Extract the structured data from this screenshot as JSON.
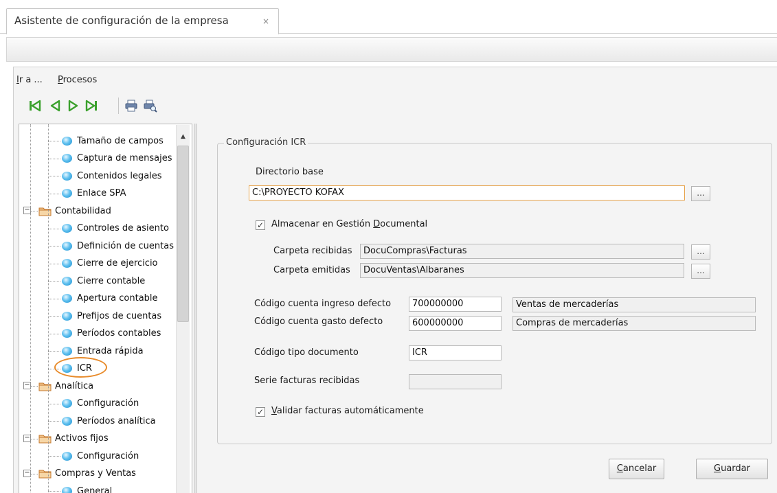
{
  "tab": {
    "title": "Asistente de configuración de la empresa",
    "close": "×"
  },
  "menu": [
    {
      "label": "Ir a ...",
      "accel": "I",
      "rest": "r a ..."
    },
    {
      "label": "Procesos",
      "accel": "P",
      "rest": "rocesos"
    }
  ],
  "toolbar": {
    "icons": [
      "first-record-icon",
      "previous-record-icon",
      "next-record-icon",
      "last-record-icon",
      "print-icon",
      "print-preview-icon"
    ]
  },
  "tree": {
    "items": [
      {
        "label": "Tamaño de campos",
        "kind": "leaf"
      },
      {
        "label": "Captura de mensajes",
        "kind": "leaf"
      },
      {
        "label": "Contenidos legales",
        "kind": "leaf"
      },
      {
        "label": "Enlace SPA",
        "kind": "leaf"
      },
      {
        "label": "Contabilidad",
        "kind": "folder",
        "expander": "−"
      },
      {
        "label": "Controles de asiento",
        "kind": "leaf"
      },
      {
        "label": "Definición de cuentas",
        "kind": "leaf"
      },
      {
        "label": "Cierre de ejercicio",
        "kind": "leaf"
      },
      {
        "label": "Cierre contable",
        "kind": "leaf"
      },
      {
        "label": "Apertura contable",
        "kind": "leaf"
      },
      {
        "label": "Prefijos de cuentas",
        "kind": "leaf"
      },
      {
        "label": "Períodos contables",
        "kind": "leaf"
      },
      {
        "label": "Entrada rápida",
        "kind": "leaf"
      },
      {
        "label": "ICR",
        "kind": "leaf",
        "selected": true
      },
      {
        "label": "Analítica",
        "kind": "folder",
        "expander": "−"
      },
      {
        "label": "Configuración",
        "kind": "leaf"
      },
      {
        "label": "Períodos analítica",
        "kind": "leaf"
      },
      {
        "label": "Activos fijos",
        "kind": "folder",
        "expander": "−"
      },
      {
        "label": "Configuración",
        "kind": "leaf"
      },
      {
        "label": "Compras y Ventas",
        "kind": "folder",
        "expander": "−"
      },
      {
        "label": "General",
        "kind": "leaf"
      }
    ],
    "scroll_up": "▲"
  },
  "form": {
    "group_title": "Configuración ICR",
    "base_dir_label": "Directorio base",
    "base_dir_value": "C:\\PROYECTO KOFAX",
    "ellipsis": "...",
    "store_dm": {
      "checked": true,
      "check_mark": "✓",
      "label_pre": "Almacenar en Gestión ",
      "accel": "D",
      "label_post": "ocumental"
    },
    "received_folder_label": "Carpeta recibidas",
    "received_folder_value": "DocuCompras\\Facturas",
    "issued_folder_label": "Carpeta emitidas",
    "issued_folder_value": "DocuVentas\\Albaranes",
    "income_account_label": "Código cuenta ingreso defecto",
    "income_account_value": "700000000",
    "income_account_desc": "Ventas de mercaderías",
    "expense_account_label": "Código cuenta gasto defecto",
    "expense_account_value": "600000000",
    "expense_account_desc": "Compras de mercaderías",
    "doc_type_label": "Código tipo documento",
    "doc_type_value": "ICR",
    "invoice_series_label": "Serie facturas recibidas",
    "invoice_series_value": "",
    "auto_validate": {
      "checked": true,
      "check_mark": "✓",
      "accel": "V",
      "label_post": "alidar facturas automáticamente"
    }
  },
  "buttons": {
    "cancel": {
      "accel": "C",
      "rest": "ancelar"
    },
    "save": {
      "accel": "G",
      "rest": "uardar"
    }
  },
  "colors": {
    "highlight_ring": "#e88b2b",
    "field_focus": "#e6a24a",
    "nav_green": "#3aa02c"
  }
}
